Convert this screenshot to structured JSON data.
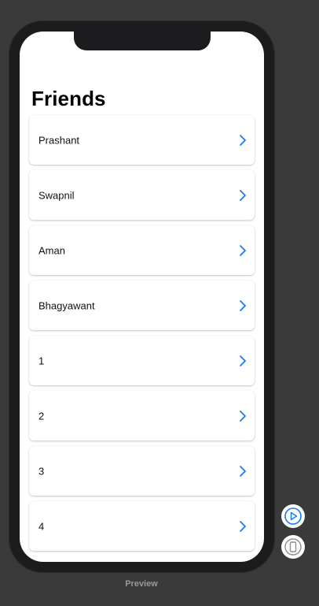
{
  "screen": {
    "title": "Friends"
  },
  "friends": [
    {
      "name": "Prashant"
    },
    {
      "name": "Swapnil"
    },
    {
      "name": "Aman"
    },
    {
      "name": "Bhagyawant"
    },
    {
      "name": "1"
    },
    {
      "name": "2"
    },
    {
      "name": "3"
    },
    {
      "name": "4"
    }
  ],
  "preview": {
    "label": "Preview"
  },
  "icons": {
    "row_accessory": "chevron-right-icon",
    "live_preview": "play-circle-icon",
    "device_settings": "device-icon"
  },
  "colors": {
    "accent": "#1a7cf5",
    "canvas": "#3a3a3a",
    "device_frame": "#1c1c1e"
  }
}
